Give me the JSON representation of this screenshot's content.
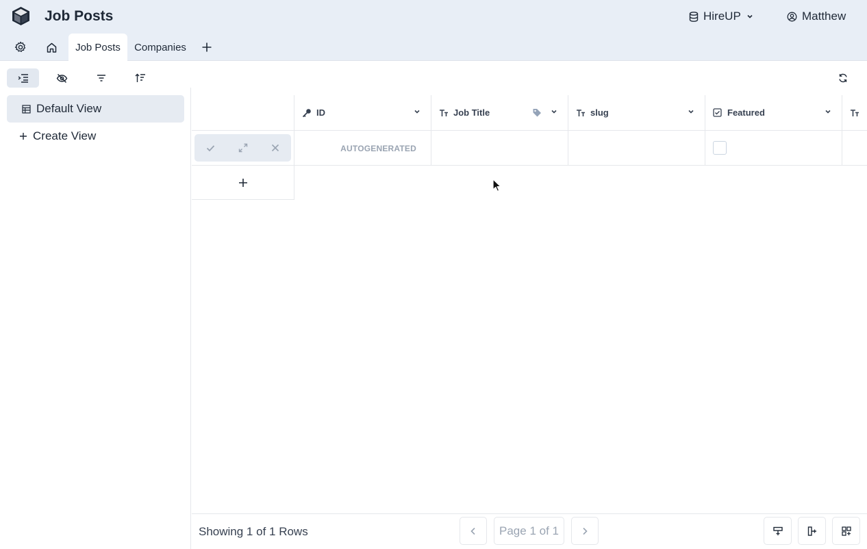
{
  "header": {
    "title": "Job Posts",
    "database": "HireUP",
    "user": "Matthew",
    "logo_icon": "cube-icon"
  },
  "tabs": [
    {
      "label": "Job Posts",
      "active": true
    },
    {
      "label": "Companies",
      "active": false
    }
  ],
  "sidebar": {
    "views": [
      {
        "label": "Default View",
        "icon": "table-icon",
        "selected": true
      },
      {
        "label": "Create View",
        "icon": "plus-icon",
        "selected": false
      }
    ]
  },
  "grid": {
    "columns": [
      {
        "label": "ID",
        "icon": "key-icon"
      },
      {
        "label": "Job Title",
        "icon": "text-type-icon"
      },
      {
        "label": "slug",
        "icon": "text-type-icon"
      },
      {
        "label": "Featured",
        "icon": "checkbox-icon"
      },
      {
        "label": "",
        "icon": "text-type-icon"
      }
    ],
    "new_row": {
      "id": "AUTOGENERATED",
      "featured": false
    }
  },
  "footer": {
    "rows_text": "Showing 1 of 1 Rows",
    "page_text": "Page 1 of 1"
  },
  "colors": {
    "header_bg": "#e8eef6",
    "selected_bg": "#e6ebf2",
    "muted_text": "#9aa4b2"
  }
}
